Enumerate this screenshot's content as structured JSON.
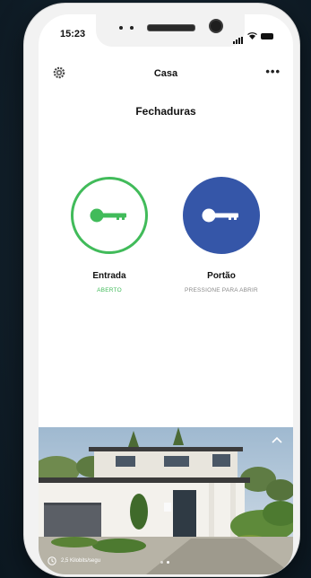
{
  "status_bar": {
    "time": "15:23"
  },
  "header": {
    "title": "Casa",
    "settings_icon": "gear-icon",
    "more_icon": "more-icon",
    "more_label": "•••"
  },
  "section": {
    "title": "Fechaduras"
  },
  "locks": [
    {
      "name": "Entrada",
      "status": "ABERTO",
      "state": "open",
      "color": "#41bb5a",
      "icon": "key-icon"
    },
    {
      "name": "Portão",
      "status": "PRESSIONE PARA ABRIR",
      "state": "closed",
      "color": "#3556a8",
      "icon": "key-icon"
    }
  ],
  "camera": {
    "caption": "2,5 Kilobits/segu",
    "collapse_icon": "chevron-up-icon",
    "history_icon": "clock-icon"
  },
  "colors": {
    "accent_open": "#41bb5a",
    "accent_closed": "#3556a8",
    "status_gray": "#8a8a8a"
  }
}
